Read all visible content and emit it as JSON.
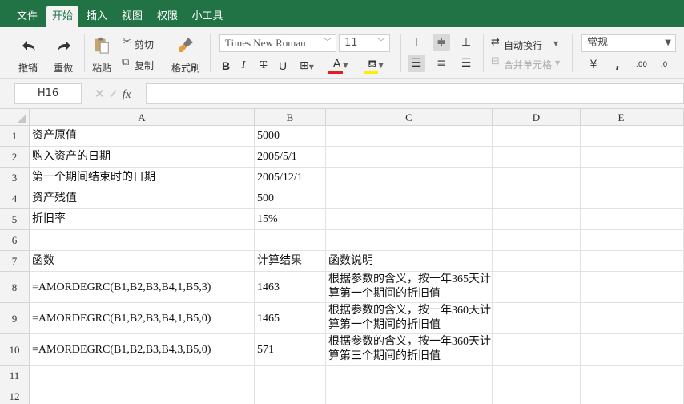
{
  "menu": {
    "items": [
      {
        "label": "文件",
        "active": false
      },
      {
        "label": "开始",
        "active": true
      },
      {
        "label": "插入",
        "active": false
      },
      {
        "label": "视图",
        "active": false
      },
      {
        "label": "权限",
        "active": false
      },
      {
        "label": "小工具",
        "active": false
      }
    ]
  },
  "ribbon": {
    "undo_label": "撤销",
    "redo_label": "重做",
    "paste_label": "粘贴",
    "cut_label": "剪切",
    "copy_label": "复制",
    "format_painter_label": "格式刷",
    "font_name": "Times New Roman",
    "font_size": "11",
    "bold": "B",
    "italic": "I",
    "strike": "T",
    "underline": "U",
    "font_color_glyph": "A",
    "wrap_text_label": "自动换行",
    "merge_label": "合并单元格",
    "number_format": "常规",
    "font_color_bar": "#e02020",
    "fill_color_bar": "#ffee00"
  },
  "formula_bar": {
    "cell_ref": "H16",
    "formula": ""
  },
  "sheet": {
    "columns": [
      "A",
      "B",
      "C",
      "D",
      "E"
    ],
    "rows": [
      {
        "num": "1",
        "a": "资产原值",
        "b": "5000",
        "c": ""
      },
      {
        "num": "2",
        "a": "购入资产的日期",
        "b": "2005/5/1",
        "c": ""
      },
      {
        "num": "3",
        "a": "第一个期间结束时的日期",
        "b": "2005/12/1",
        "c": ""
      },
      {
        "num": "4",
        "a": "资产残值",
        "b": "500",
        "c": ""
      },
      {
        "num": "5",
        "a": "折旧率",
        "b": "15%",
        "c": ""
      },
      {
        "num": "6",
        "a": "",
        "b": "",
        "c": ""
      },
      {
        "num": "7",
        "a": "函数",
        "b": "计算结果",
        "c": "函数说明"
      },
      {
        "num": "8",
        "a": "=AMORDEGRC(B1,B2,B3,B4,1,B5,3)",
        "b": "1463",
        "c": "根据参数的含义，按一年365天计算第一个期间的折旧值"
      },
      {
        "num": "9",
        "a": "=AMORDEGRC(B1,B2,B3,B4,1,B5,0)",
        "b": "1465",
        "c": "根据参数的含义，按一年360天计算第一个期间的折旧值"
      },
      {
        "num": "10",
        "a": "=AMORDEGRC(B1,B2,B3,B4,3,B5,0)",
        "b": "571",
        "c": "根据参数的含义，按一年360天计算第三个期间的折旧值"
      },
      {
        "num": "11",
        "a": "",
        "b": "",
        "c": ""
      },
      {
        "num": "12",
        "a": "",
        "b": "",
        "c": ""
      }
    ]
  }
}
